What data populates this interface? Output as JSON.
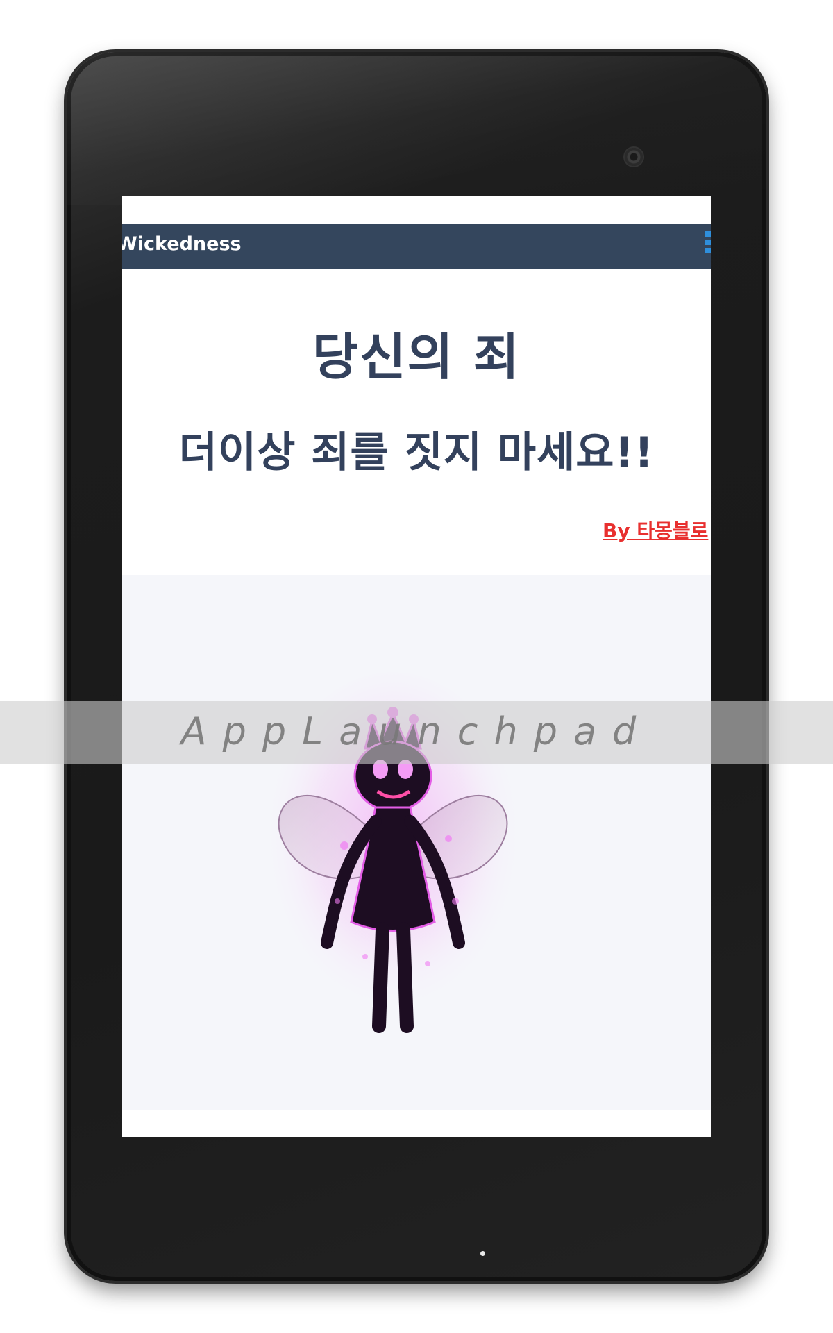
{
  "app_bar": {
    "title": "Wickedness"
  },
  "content": {
    "headline": "당신의 죄",
    "subheadline": "더이상 죄를 짓지 마세요!!",
    "byline": "By 타몽블로"
  },
  "watermark": {
    "text": "AppLaunchpad"
  },
  "colors": {
    "app_bar": "#34465d",
    "headline": "#33415c",
    "byline": "#e8302f",
    "menu_icon": "#2f8fdc",
    "image_background": "#f5f6fa",
    "fairy_glow": "#e35de6"
  },
  "icons": {
    "menu": "overflow-menu-icon",
    "illustration": "dark-fairy-illustration"
  }
}
